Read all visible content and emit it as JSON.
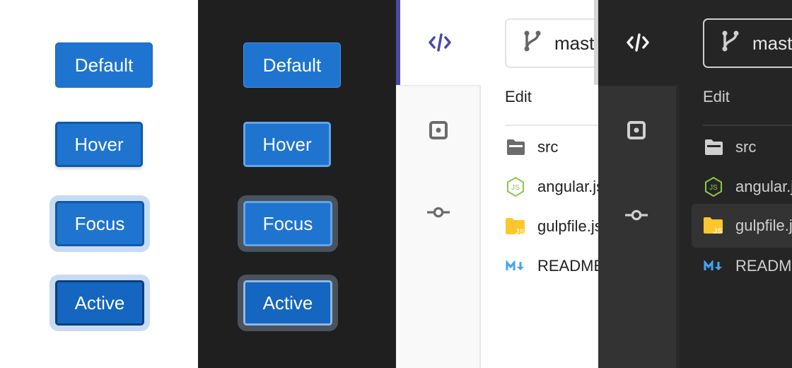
{
  "button_states": {
    "light": [
      "Default",
      "Hover",
      "Focus",
      "Active"
    ],
    "dark": [
      "Default",
      "Hover",
      "Focus",
      "Active"
    ]
  },
  "ide_light": {
    "branch": "master",
    "menu_label": "Edit",
    "files": [
      {
        "name": "src",
        "icon": "folder-icon"
      },
      {
        "name": "angular.json",
        "icon": "nodejs-icon"
      },
      {
        "name": "gulpfile.js",
        "icon": "js-folder-icon"
      },
      {
        "name": "README.md",
        "icon": "markdown-icon"
      }
    ],
    "accent": "#4a4aa8"
  },
  "ide_dark": {
    "branch": "master",
    "menu_label": "Edit",
    "files": [
      {
        "name": "src",
        "icon": "folder-icon"
      },
      {
        "name": "angular.json",
        "icon": "nodejs-icon"
      },
      {
        "name": "gulpfile.js",
        "icon": "js-folder-icon",
        "selected": true
      },
      {
        "name": "README.md",
        "icon": "markdown-icon"
      }
    ]
  },
  "colors": {
    "button_blue": "#1f74cf",
    "focus_ring_light": "#c7dcf2",
    "focus_ring_dark": "#4a525c",
    "node_green": "#8cc84b",
    "js_yellow": "#fcc72c",
    "markdown_blue": "#42a5f5"
  }
}
